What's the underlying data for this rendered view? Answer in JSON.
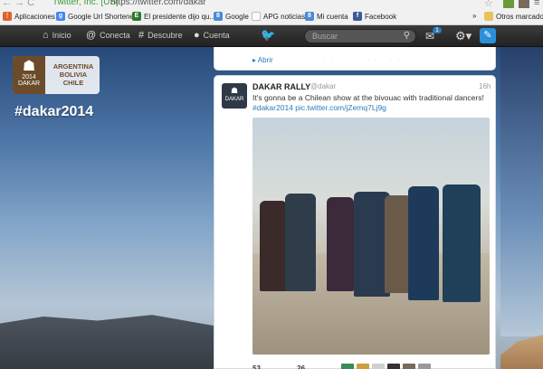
{
  "browser": {
    "secure_label": "Twitter, Inc. [US]",
    "url": "https://twitter.com/dakar"
  },
  "bookmarks": {
    "apps": "Aplicaciones",
    "items": [
      "Google Url Shortener",
      "El presidente dijo qu...",
      "Google",
      "APG noticias",
      "Mi cuenta",
      "Facebook"
    ],
    "overflow": "»",
    "other": "Otros marcadores"
  },
  "topbar": {
    "home": "Inicio",
    "connect": "Conecta",
    "discover": "Descubre",
    "account": "Cuenta",
    "search_placeholder": "Buscar",
    "mail_badge": "1"
  },
  "profile": {
    "logo_countries": [
      "ARGENTINA",
      "BOLIVIA",
      "CHILE"
    ],
    "logo_year": "2014",
    "logo_brand": "DAKAR",
    "hashtag": "#dakar2014"
  },
  "prev_tweet": {
    "action": "Abrir"
  },
  "tweet": {
    "name": "DAKAR RALLY",
    "handle": "@dakar",
    "time": "16h",
    "text": "It's gonna be a Chilean show at the bivouac with traditional dancers!",
    "hashtag": "#dakar2014",
    "link": "pic.twitter.com/jZemq7Lj9g",
    "retweets": "53",
    "favorites": "26",
    "avatar_label": "DAKAR"
  },
  "colors": {
    "twitter_blue": "#2b7bb9",
    "topbar": "#2b2b2b",
    "dakar_brown": "#6b4b2a"
  }
}
